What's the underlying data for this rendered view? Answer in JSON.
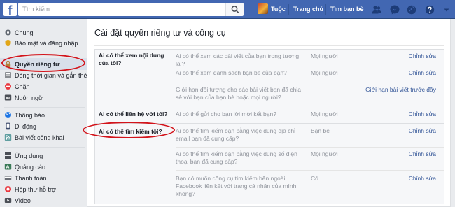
{
  "topbar": {
    "logo_letter": "f",
    "search_placeholder": "Tìm kiếm",
    "profile_name": "Tuộc",
    "home_label": "Trang chủ",
    "find_friends_label": "Tìm bạn bè"
  },
  "sidebar": {
    "items": [
      {
        "label": "Chung",
        "icon": "gear-icon",
        "color": "#606770"
      },
      {
        "label": "Bảo mật và đăng nhập",
        "icon": "shield-icon",
        "color": "#e2a617"
      },
      {
        "label": "Quyền riêng tư",
        "icon": "lock-icon",
        "color": "#b27f38"
      },
      {
        "label": "Dòng thời gian và gắn thẻ",
        "icon": "timeline-icon",
        "color": "#8a8d91"
      },
      {
        "label": "Chặn",
        "icon": "block-icon",
        "color": "#e9383f"
      },
      {
        "label": "Ngôn ngữ",
        "icon": "language-icon",
        "color": "#4b4f56"
      },
      {
        "label": "Thông báo",
        "icon": "globe-icon",
        "color": "#1b74e4"
      },
      {
        "label": "Di động",
        "icon": "mobile-icon",
        "color": "#3b4a6b"
      },
      {
        "label": "Bài viết công khai",
        "icon": "rss-icon",
        "color": "#5f9ea0"
      },
      {
        "label": "Ứng dụng",
        "icon": "apps-icon",
        "color": "#4b4f56"
      },
      {
        "label": "Quảng cáo",
        "icon": "ads-icon",
        "color": "#3b7a57"
      },
      {
        "label": "Thanh toán",
        "icon": "card-icon",
        "color": "#6b6f76"
      },
      {
        "label": "Hộp thư hỗ trợ",
        "icon": "lifebuoy-icon",
        "color": "#e9383f"
      },
      {
        "label": "Video",
        "icon": "video-icon",
        "color": "#4b4f56"
      }
    ]
  },
  "main": {
    "title": "Cài đặt quyền riêng tư và công cụ",
    "sections": [
      {
        "heading": "Ai có thể xem nội dung của tôi?",
        "rows": [
          {
            "question": "Ai có thể xem các bài viết của bạn trong tương lai?",
            "value": "Mọi người",
            "edit": "Chỉnh sửa"
          },
          {
            "question": "Ai có thể xem danh sách bạn bè của bạn?",
            "value": "Mọi người",
            "edit": "Chỉnh sửa"
          },
          {
            "question": "Giới hạn đối tượng cho các bài viết bạn đã chia sẻ với bạn của bạn bè hoặc mọi người?",
            "value": "",
            "edit": "Giới hạn bài viết trước đây"
          }
        ]
      },
      {
        "heading": "Ai có thể liên hệ với tôi?",
        "rows": [
          {
            "question": "Ai có thể gửi cho bạn lời mời kết bạn?",
            "value": "Mọi người",
            "edit": "Chỉnh sửa"
          }
        ]
      },
      {
        "heading": "Ai có thể tìm kiếm tôi?",
        "rows": [
          {
            "question": "Ai có thể tìm kiếm bạn bằng việc dùng địa chỉ email bạn đã cung cấp?",
            "value": "Bạn bè",
            "edit": "Chỉnh sửa"
          },
          {
            "question": "Ai có thể tìm kiếm bạn bằng việc dùng số điện thoại bạn đã cung cấp?",
            "value": "Mọi người",
            "edit": "Chỉnh sửa"
          },
          {
            "question": "Bạn có muốn công cụ tìm kiếm bên ngoài Facebook liên kết với trang cá nhân của mình không?",
            "value": "Có",
            "edit": "Chỉnh sửa"
          }
        ]
      }
    ]
  },
  "colors": {
    "brand_blue": "#4267b2",
    "link_blue": "#365899",
    "highlight_oval": "#d3131a"
  }
}
